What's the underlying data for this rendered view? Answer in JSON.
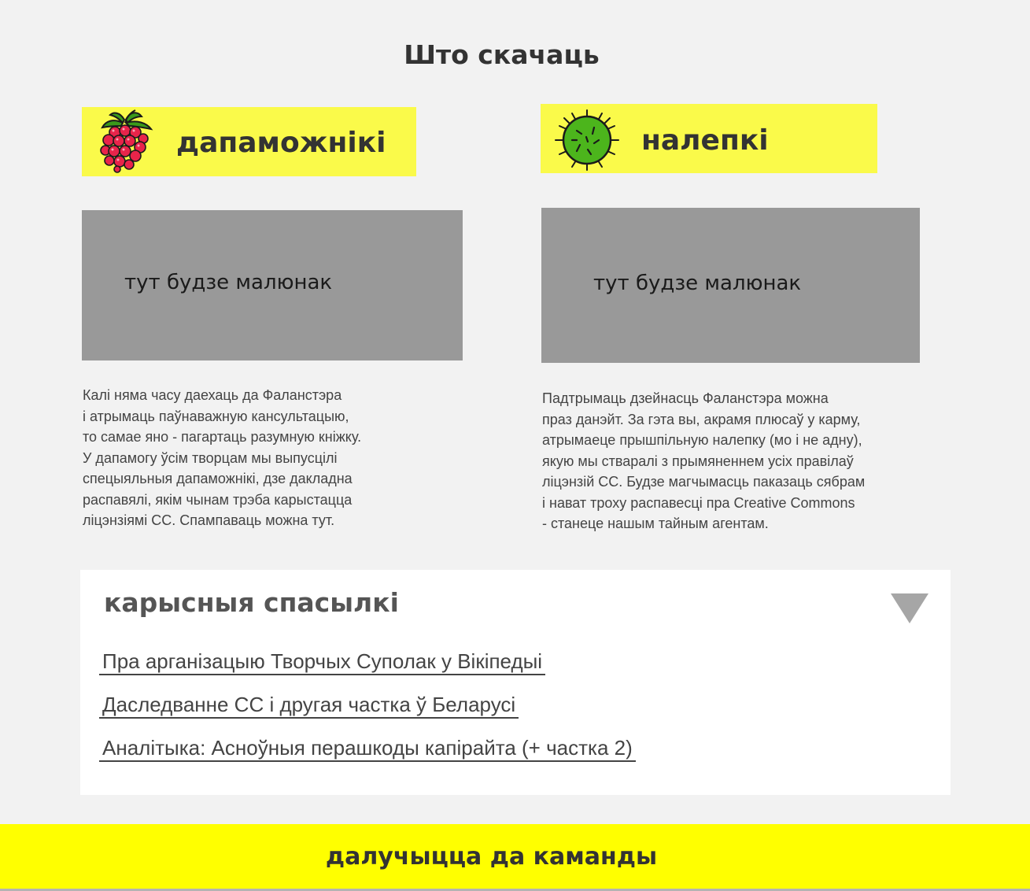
{
  "page": {
    "title": "Што скачаць"
  },
  "cards": {
    "guides": {
      "icon": "raspberry-icon",
      "label": "дапаможнікі",
      "image_placeholder": "тут будзе малюнак",
      "description": "Калі няма часу даехаць да Фаланстэра\nі атрымаць паўнаважную кансультацыю,\nто самае яно - пагартаць разумную кніжку.\nУ дапамогу ўсім творцам  мы выпусцілі\nспецыяльныя дапаможнікі, дзе дакладна\nраспавялі, якім чынам трэба карыстацца\nліцэнзіямі СС. Спампаваць можна тут."
    },
    "stickers": {
      "icon": "green-germ-icon",
      "label": "налепкі",
      "image_placeholder": "тут будзе малюнак",
      "description": "Падтрымаць дзейнасць Фаланстэра можна\nпраз данэйт. За гэта вы, акрамя плюсаў у карму,\nатрымаеце прышпільную налепку (мо і не адну),\nякую мы стваралі з прымяненнем усіх правілаў\nліцэнзій СС. Будзе магчымасць паказаць сябрам\nі нават троху распавесці пра Creative Commons\n- станеце нашым тайным агентам."
    }
  },
  "links": {
    "title": "карысныя спасылкі",
    "toggle_icon": "triangle-down-icon",
    "items": [
      {
        "label": "Пра арганізацыю Творчых Суполак у Вікіпедыі "
      },
      {
        "label": "Даследванне СС і другая частка ў Беларусі "
      },
      {
        "label": "Аналітыка: Асноўныя перашкоды капірайта (+ частка 2)"
      }
    ]
  },
  "footer": {
    "label": "далучыцца да каманды"
  },
  "colors": {
    "background": "#f2f2f2",
    "header_yellow": "#fafa4a",
    "footer_yellow": "#ffff00",
    "placeholder_gray": "#999999",
    "panel_white": "#ffffff"
  }
}
